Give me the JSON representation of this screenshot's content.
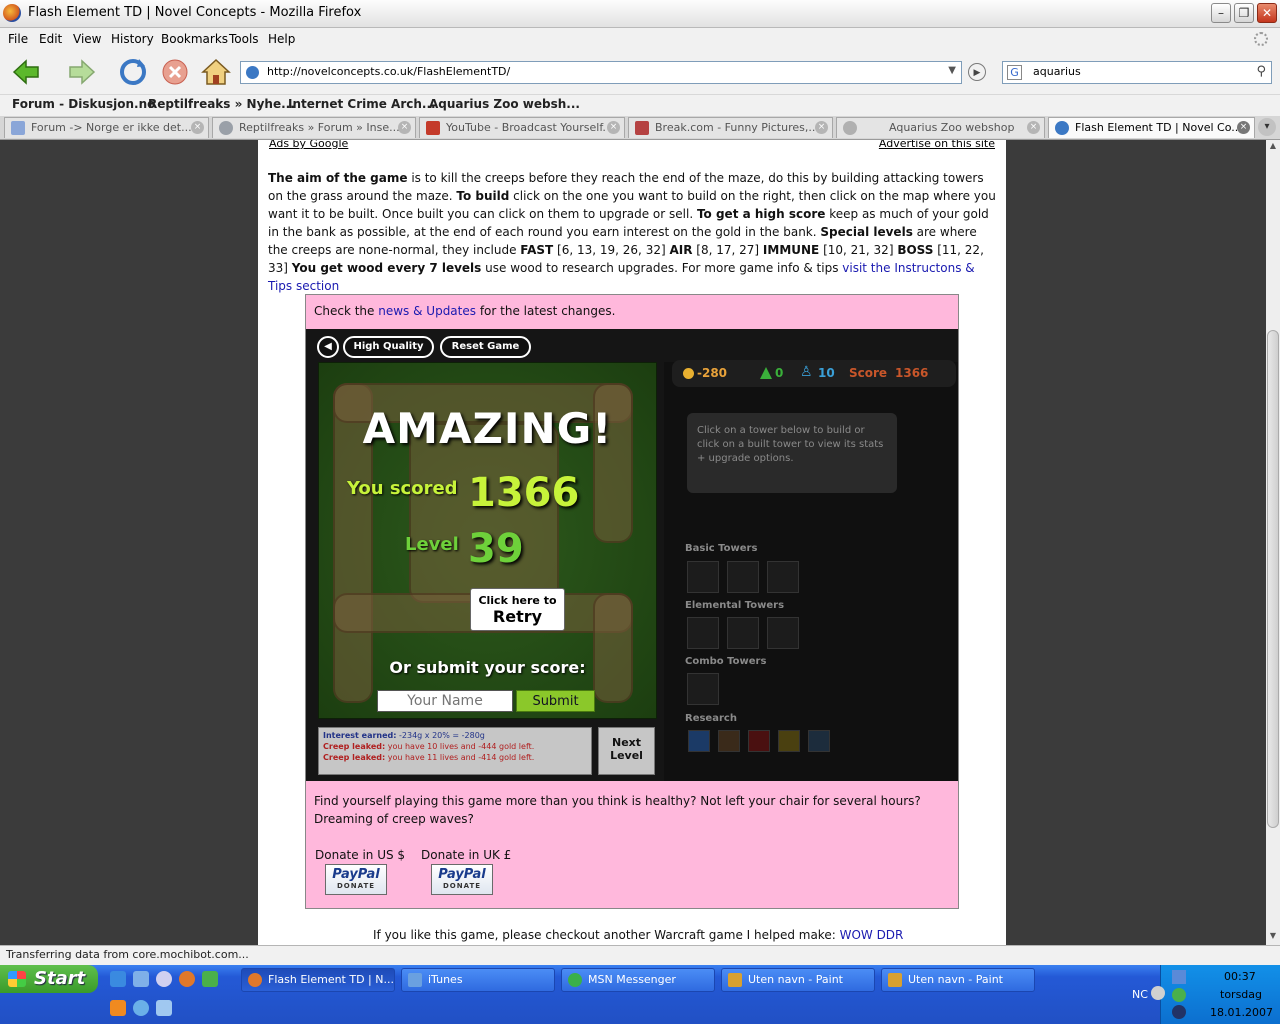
{
  "window": {
    "title": "Flash Element TD | Novel Concepts - Mozilla Firefox",
    "minimize": "–",
    "maximize": "❐",
    "close": "✕"
  },
  "menu": [
    "File",
    "Edit",
    "View",
    "History",
    "Bookmarks",
    "Tools",
    "Help"
  ],
  "toolbar": {
    "url": "http://novelconcepts.co.uk/FlashElementTD/",
    "search_value": "aquarius",
    "search_engine": "G",
    "go": "▶",
    "url_drop": "▼",
    "search_icon": "⚲"
  },
  "bookmarks": [
    "Forum - Diskusjon.no",
    "Reptilfreaks » Nyhe...",
    "Internet Crime Arch...",
    "Aquarius Zoo websh..."
  ],
  "tabs": [
    {
      "label": "Forum -> Norge er ikke det...",
      "color": "#8aa6d8"
    },
    {
      "label": "Reptilfreaks » Forum » Inse...",
      "color": "#9aa0a8"
    },
    {
      "label": "YouTube - Broadcast Yourself.",
      "color": "#c43a2a"
    },
    {
      "label": "Break.com - Funny Pictures,...",
      "color": "#b54242"
    },
    {
      "label": "Aquarius Zoo webshop",
      "color": "#b0b0b0"
    },
    {
      "label": "Flash Element TD | Novel Co...",
      "color": "#3b78c4"
    }
  ],
  "tab_close": "×",
  "page": {
    "ads_by_google": "Ads by Google",
    "advertise": "Advertise on this site",
    "intro": {
      "aim_bold": "The aim of the game",
      "aim_text": " is to kill the creeps before they reach the end of the maze, do this by building attacking towers on the grass around the maze. ",
      "build_bold": "To build",
      "build_text": " click on the one you want to build on the right, then click on the map where you want it to be built. Once built you can click on them to upgrade or sell. ",
      "score_bold": "To get a high score",
      "score_text": " keep as much of your gold in the bank as possible, at the end of each round you earn interest on the gold in the bank. ",
      "special_bold": "Special levels",
      "special_text": " are where the creeps are none-normal, they include ",
      "fast_bold": "FAST",
      "fast_levels": " [6, 13, 19, 26, 32] ",
      "air_bold": "AIR",
      "air_levels": " [8, 17, 27] ",
      "immune_bold": "IMMUNE",
      "immune_levels": " [10, 21, 32] ",
      "boss_bold": "BOSS",
      "boss_levels": " [11, 22, 33] ",
      "wood_bold": "You get wood every 7 levels",
      "wood_text": " use wood to research upgrades. For more game info & tips ",
      "instructions_link": "visit the Instructons & Tips section"
    },
    "check_prefix": "Check the ",
    "news_link": "news & Updates",
    "check_suffix": " for the latest changes.",
    "below_text": "Find yourself playing this game more than you think is healthy? Not left your chair for several hours? Dreaming of creep waves?",
    "donate_us": "Donate in US $",
    "donate_uk": "Donate in UK £",
    "paypal": "PayPal",
    "paypal_donate": "DONATE",
    "footer_prefix": "If you like this game, please checkout another Warcraft game I helped make: ",
    "footer_link": "WOW DDR"
  },
  "game": {
    "high_quality": "High Quality",
    "reset_game": "Reset Game",
    "sound_icon": "◀",
    "amazing": "AMAZING!",
    "you_scored": "You scored",
    "score": "1366",
    "level_label": "Level",
    "level": "39",
    "retry_small": "Click here to",
    "retry_big": "Retry",
    "submit_title": "Or submit your score:",
    "name_placeholder": "Your Name",
    "submit": "Submit",
    "log": {
      "interest_label": "Interest earned:",
      "interest_value": " -234g x 20% = -280g",
      "leak1_label": "Creep leaked:",
      "leak1_value": " you have 10 lives and -444 gold left.",
      "leak2_label": "Creep leaked:",
      "leak2_value": " you have 11 lives and -414 gold left."
    },
    "next_level": "Next Level",
    "stats": {
      "gold": "-280",
      "wood": "0",
      "lives": "10",
      "score_label": "Score",
      "score": "1366"
    },
    "info_text": "Click on a tower below to build or click on a built tower to view its stats + upgrade options.",
    "sections": [
      "Basic Towers",
      "Elemental Towers",
      "Combo Towers",
      "Research"
    ]
  },
  "status": "Transferring data from core.mochibot.com...",
  "taskbar": {
    "start": "Start",
    "tasks": [
      {
        "label": "Flash Element TD | N...",
        "color": "#e0782a"
      },
      {
        "label": "iTunes",
        "color": "#6aa0e0"
      },
      {
        "label": "MSN Messenger",
        "color": "#3ab04a"
      },
      {
        "label": "Uten navn - Paint",
        "color": "#d8a030"
      },
      {
        "label": "Uten navn - Paint",
        "color": "#d8a030"
      }
    ],
    "lang": "NC",
    "time": "00:37",
    "day": "torsdag",
    "date": "18.01.2007"
  },
  "colors": {
    "pink": "#ffb8dc",
    "score_green": "#c7f33a",
    "level_green": "#6ed13a",
    "gold_stat": "#e8a23a",
    "wood_stat": "#3ab03a",
    "lives_stat": "#3aa0d8",
    "score_stat": "#c8562a"
  }
}
